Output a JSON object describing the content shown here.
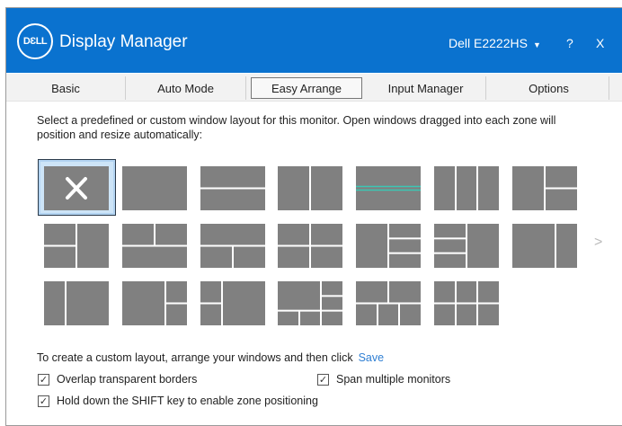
{
  "header": {
    "logo_text": "DELL",
    "title": "Display Manager",
    "monitor": "Dell E2222HS",
    "help": "?",
    "close": "X"
  },
  "tabs": [
    {
      "label": "Basic"
    },
    {
      "label": "Auto Mode"
    },
    {
      "label": "Easy Arrange",
      "selected": true
    },
    {
      "label": "Input Manager"
    },
    {
      "label": "Options"
    }
  ],
  "main": {
    "description": "Select a predefined or custom window layout for this monitor.  Open windows dragged into each zone will position and resize automatically:",
    "selected_layout_index": 0,
    "next_page": ">",
    "custom_text": "To create a custom layout, arrange your windows and then click",
    "save_link": "Save",
    "options": [
      {
        "label": "Overlap transparent borders",
        "checked": true
      },
      {
        "label": "Span multiple monitors",
        "checked": true
      },
      {
        "label": "Hold down the SHIFT key to enable zone positioning",
        "checked": true
      }
    ]
  },
  "colors": {
    "title_bar": "#0a72cf",
    "zone": "#808080",
    "accent_line": "#3cc6b4",
    "link": "#2f7fd3"
  }
}
